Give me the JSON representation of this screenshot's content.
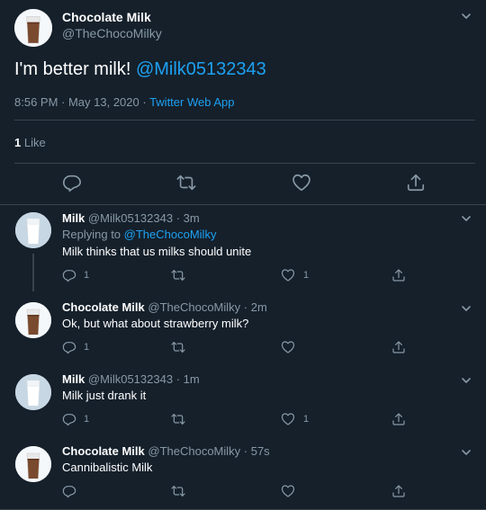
{
  "main_tweet": {
    "author_name": "Chocolate Milk",
    "author_handle": "@TheChocoMilky",
    "text_plain": "I'm better milk! ",
    "text_mention": "@Milk05132343",
    "time": "8:56 PM · May 13, 2020 · ",
    "source": "Twitter Web App",
    "likes_count": "1",
    "likes_label": " Like",
    "avatar": "chocolate-milk-glass"
  },
  "replies": [
    {
      "author_name": "Milk",
      "author_handle": "@Milk05132343",
      "time": " · 3m",
      "replying_prefix": "Replying to ",
      "replying_to": "@TheChocoMilky",
      "text": "Milk thinks that us milks should unite",
      "reply_count": "1",
      "like_count": "1",
      "avatar": "milk-glass"
    },
    {
      "author_name": "Chocolate Milk",
      "author_handle": "@TheChocoMilky",
      "time": " · 2m",
      "text": "Ok, but what about strawberry milk?",
      "reply_count": "1",
      "like_count": "",
      "avatar": "chocolate-milk-glass"
    },
    {
      "author_name": "Milk",
      "author_handle": "@Milk05132343",
      "time": " · 1m",
      "text": "Milk just drank it",
      "reply_count": "1",
      "like_count": "1",
      "avatar": "milk-glass"
    },
    {
      "author_name": "Chocolate Milk",
      "author_handle": "@TheChocoMilky",
      "time": " · 57s",
      "text": "Cannibalistic Milk",
      "reply_count": "",
      "like_count": "",
      "avatar": "chocolate-milk-glass"
    }
  ],
  "colors": {
    "background": "#15202b",
    "text": "#ffffff",
    "muted": "#8899a6",
    "link": "#1da1f2",
    "border": "#38444d"
  }
}
